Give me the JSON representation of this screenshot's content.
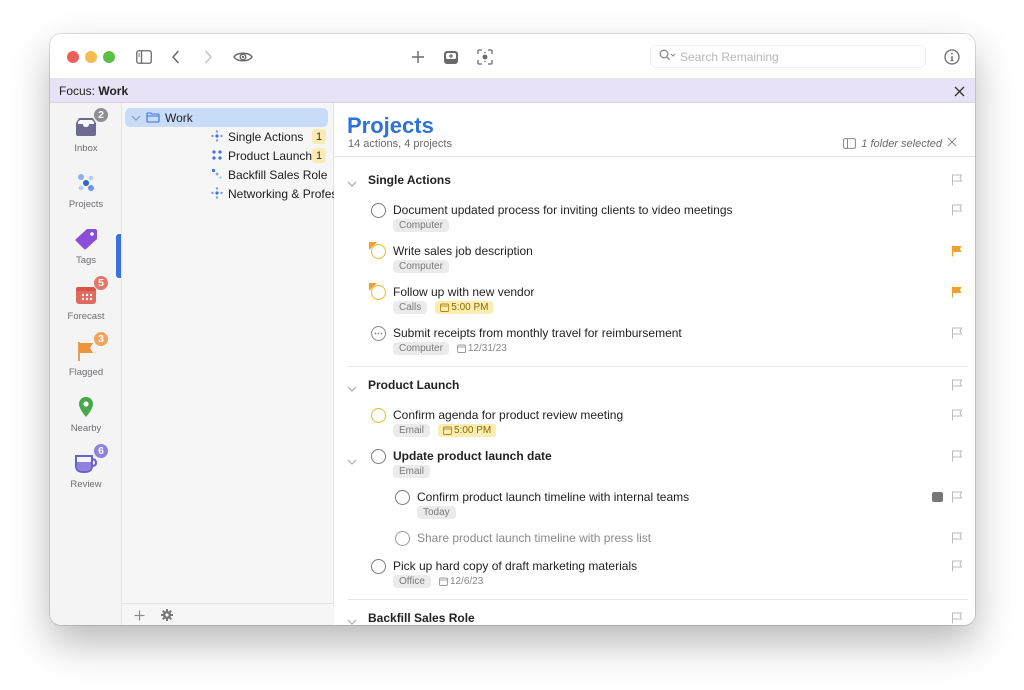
{
  "window": {
    "search": {
      "placeholder": "Search Remaining",
      "value": ""
    }
  },
  "focus": {
    "prefix": "Focus:",
    "name": "Work"
  },
  "perspectives": [
    {
      "label": "Inbox",
      "icon": "inbox-icon",
      "badge": "2",
      "color": "#6e6b93",
      "badge_color": "#8e8e93"
    },
    {
      "label": "Projects",
      "icon": "projects-icon",
      "badge": null,
      "color": "#3a70e0"
    },
    {
      "label": "Tags",
      "icon": "tag-icon",
      "badge": null,
      "color": "#8a4fd8"
    },
    {
      "label": "Forecast",
      "icon": "forecast-icon",
      "badge": "5",
      "color": "#e06a5e",
      "badge_color": "#e4766c"
    },
    {
      "label": "Flagged",
      "icon": "flag-icon",
      "badge": "3",
      "color": "#f0943a",
      "badge_color": "#f2a35e"
    },
    {
      "label": "Nearby",
      "icon": "location-pin-icon",
      "badge": null,
      "color": "#45a84a"
    },
    {
      "label": "Review",
      "icon": "review-icon",
      "badge": "6",
      "color": "#6a5fd0",
      "badge_color": "#8d82dc"
    }
  ],
  "sidebar": {
    "folder": {
      "label": "Work",
      "icon": "folder-icon"
    },
    "projects": [
      {
        "label": "Single Actions",
        "icon": "single-actions-icon",
        "count": "1"
      },
      {
        "label": "Product Launch",
        "icon": "parallel-project-icon",
        "count": "1"
      },
      {
        "label": "Backfill Sales Role",
        "icon": "sequential-project-icon",
        "count": null
      },
      {
        "label": "Networking & Professional Development",
        "icon": "single-actions-icon",
        "count": null
      }
    ]
  },
  "main": {
    "title": "Projects",
    "subtitle": "14 actions, 4 projects",
    "selection": "1 folder selected",
    "sections": [
      {
        "title": "Single Actions",
        "tasks": [
          {
            "title": "Document updated process for inviting clients to video meetings",
            "tags": [
              "Computer"
            ],
            "due": null,
            "date": null,
            "flagged": false,
            "status": "available"
          },
          {
            "title": "Write sales job description",
            "tags": [
              "Computer"
            ],
            "due": null,
            "date": null,
            "flagged": true,
            "status": "flagged"
          },
          {
            "title": "Follow up with new vendor",
            "tags": [
              "Calls"
            ],
            "due": "5:00 PM",
            "date": null,
            "flagged": true,
            "status": "flagged"
          },
          {
            "title": "Submit receipts from monthly travel for reimbursement",
            "tags": [
              "Computer"
            ],
            "due": null,
            "date": "12/31/23",
            "flagged": false,
            "status": "deferred"
          }
        ]
      },
      {
        "title": "Product Launch",
        "tasks": [
          {
            "title": "Confirm agenda for product review meeting",
            "tags": [
              "Email"
            ],
            "due": "5:00 PM",
            "date": null,
            "flagged": false,
            "status": "due"
          },
          {
            "title": "Update product launch date",
            "tags": [
              "Email"
            ],
            "due": null,
            "date": null,
            "flagged": false,
            "status": "available",
            "group": true
          },
          {
            "title": "Confirm product launch timeline with internal teams",
            "tags": [
              "Today"
            ],
            "due": null,
            "date": null,
            "flagged": false,
            "status": "available",
            "has_note": true,
            "child": true
          },
          {
            "title": "Share product launch timeline with press list",
            "tags": [],
            "due": null,
            "date": null,
            "flagged": false,
            "status": "blocked",
            "child": true
          },
          {
            "title": "Pick up hard copy of draft marketing materials",
            "tags": [
              "Office"
            ],
            "due": null,
            "date": "12/6/23",
            "flagged": false,
            "status": "available"
          }
        ]
      },
      {
        "title": "Backfill Sales Role",
        "tasks": []
      }
    ]
  },
  "colors": {
    "accent": "#2f72d8",
    "flag": "#f0a030",
    "due": "#fbedb1",
    "focus_bar": "#e8e2f7",
    "selection": "#c9dcf7"
  }
}
